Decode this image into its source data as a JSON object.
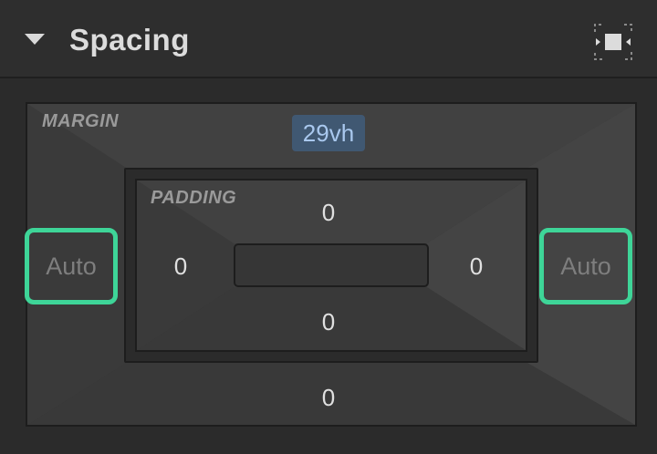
{
  "header": {
    "title": "Spacing",
    "collapse_icon": "caret-down-icon",
    "mode_icon": "spacing-mode-icon"
  },
  "margin": {
    "label": "MARGIN",
    "top": "29vh",
    "right": "Auto",
    "bottom": "0",
    "left": "Auto"
  },
  "padding": {
    "label": "PADDING",
    "top": "0",
    "right": "0",
    "bottom": "0",
    "left": "0"
  },
  "colors": {
    "highlight": "#3ed598",
    "selected_value_bg": "#405872"
  }
}
